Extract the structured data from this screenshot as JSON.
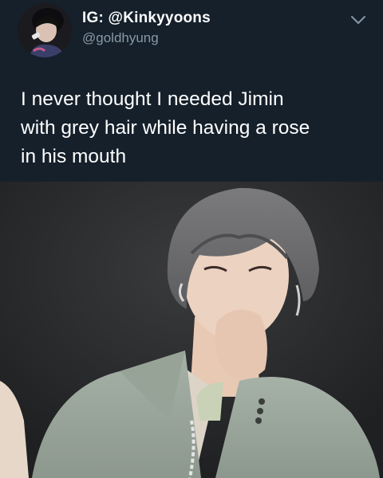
{
  "tweet": {
    "display_name": "IG: @Kinkyyoons",
    "handle": "@goldhyung",
    "text": "I never thought I needed Jimin\nwith grey hair while having a rose\nin his mouth",
    "menu_icon": "chevron-down-icon",
    "media_description_icon": "photo"
  },
  "colors": {
    "background": "#15202b",
    "primary_text": "#ffffff",
    "secondary_text": "#8899a6"
  }
}
